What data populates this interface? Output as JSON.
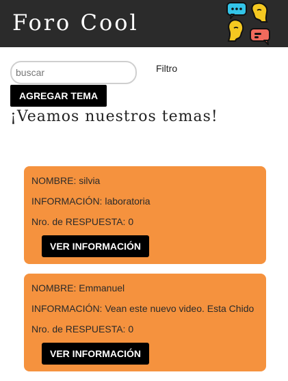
{
  "header": {
    "title": "Foro Cool"
  },
  "toolbar": {
    "search_placeholder": "buscar",
    "search_value": "",
    "filter_label": "Filtro",
    "add_button": "AGREGAR TEMA"
  },
  "main": {
    "heading": "¡Veamos nuestros temas!",
    "topics": [
      {
        "nombre": "NOMBRE: silvia",
        "informacion": "INFORMACIÓN: laboratoria",
        "respuestas": "Nro. de RESPUESTA: 0",
        "button": "VER INFORMACIÓN"
      },
      {
        "nombre": "NOMBRE: Emmanuel",
        "informacion": "INFORMACIÓN: Vean este nuevo video. Esta Chido",
        "respuestas": "Nro. de RESPUESTA: 0",
        "button": "VER INFORMACIÓN"
      }
    ]
  },
  "colors": {
    "header_bg": "#2b2b2b",
    "card_bg": "#f5923e",
    "button_bg": "#000000"
  },
  "icons": {
    "logo": "chat-people-logo-icon"
  }
}
